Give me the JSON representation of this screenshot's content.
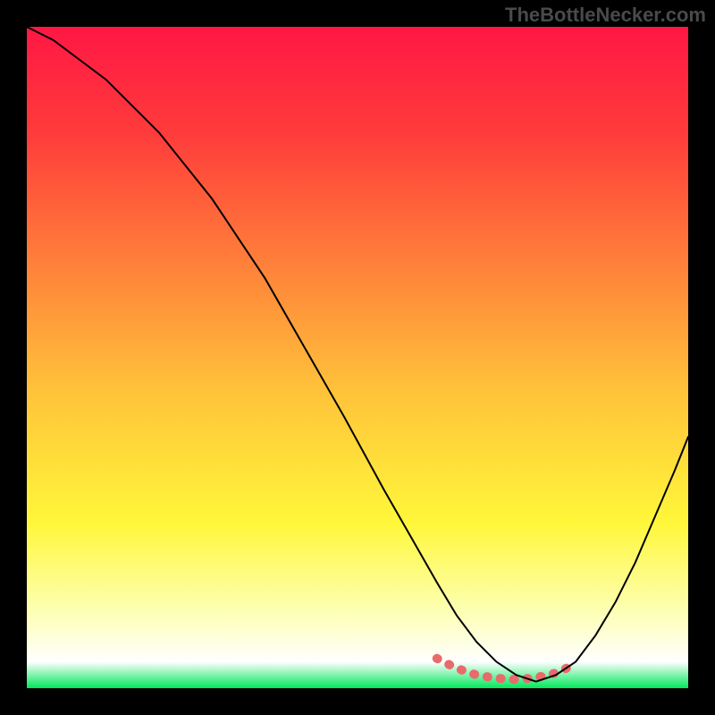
{
  "watermark": "TheBottleNecker.com",
  "chart_data": {
    "type": "line",
    "title": "",
    "xlabel": "",
    "ylabel": "",
    "xlim": [
      0,
      100
    ],
    "ylim": [
      0,
      100
    ],
    "background_gradient": {
      "stops": [
        {
          "offset": 0,
          "color": "#ff1744"
        },
        {
          "offset": 16,
          "color": "#ff3b3b"
        },
        {
          "offset": 34,
          "color": "#ff7a3a"
        },
        {
          "offset": 55,
          "color": "#ffc23a"
        },
        {
          "offset": 75,
          "color": "#fff73a"
        },
        {
          "offset": 88,
          "color": "#fdffb0"
        },
        {
          "offset": 96,
          "color": "#ffffff"
        },
        {
          "offset": 100,
          "color": "#00e85a"
        }
      ]
    },
    "series": [
      {
        "name": "bottleneck-curve",
        "color": "#000000",
        "stroke_width": 2,
        "x": [
          0,
          4,
          8,
          12,
          16,
          20,
          24,
          28,
          32,
          36,
          40,
          44,
          48,
          54,
          58,
          62,
          65,
          68,
          71,
          74,
          77,
          80,
          83,
          86,
          89,
          92,
          95,
          98,
          100
        ],
        "values": [
          100,
          98,
          95,
          92,
          88,
          84,
          79,
          74,
          68,
          62,
          55,
          48,
          41,
          30,
          23,
          16,
          11,
          7,
          4,
          2,
          1,
          2,
          4,
          8,
          13,
          19,
          26,
          33,
          38
        ]
      }
    ],
    "highlight_segment": {
      "name": "optimal-zone",
      "color": "#e86a6a",
      "stroke_width": 10,
      "x": [
        62,
        65,
        68,
        71,
        74,
        76,
        78,
        80,
        82
      ],
      "values": [
        4.5,
        3.0,
        2.0,
        1.5,
        1.3,
        1.5,
        1.8,
        2.3,
        3.2
      ]
    }
  }
}
